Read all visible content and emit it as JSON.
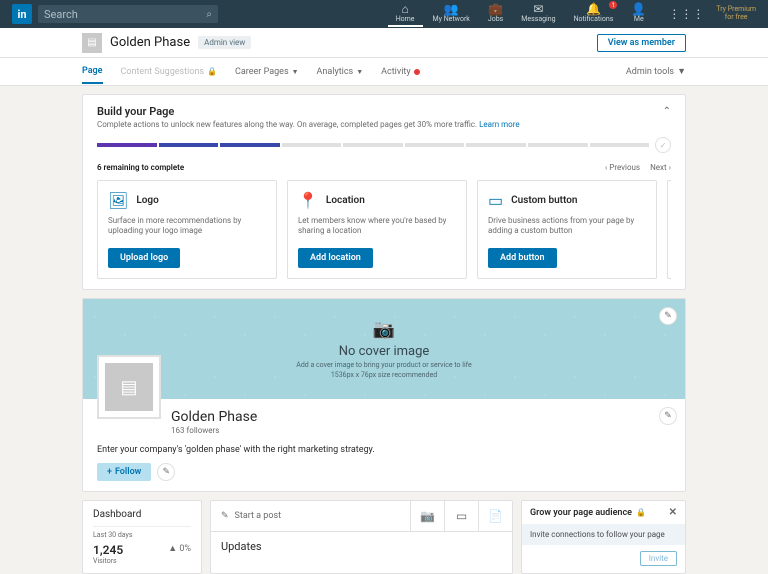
{
  "nav": {
    "search_placeholder": "Search",
    "items": [
      {
        "label": "Home",
        "icon": "home"
      },
      {
        "label": "My Network",
        "icon": "network"
      },
      {
        "label": "Jobs",
        "icon": "jobs"
      },
      {
        "label": "Messaging",
        "icon": "msg"
      },
      {
        "label": "Notifications",
        "icon": "bell",
        "badge": "1"
      },
      {
        "label": "Me",
        "icon": "me"
      }
    ],
    "premium_line1": "Try Premium",
    "premium_line2": "for free"
  },
  "header": {
    "page_name": "Golden Phase",
    "admin_badge": "Admin view",
    "view_as_member": "View as member"
  },
  "tabs": {
    "page": "Page",
    "content_suggestions": "Content Suggestions",
    "career_pages": "Career Pages",
    "analytics": "Analytics",
    "activity": "Activity",
    "admin_tools": "Admin tools"
  },
  "build": {
    "title": "Build your Page",
    "subtitle": "Complete actions to unlock new features along the way. On average, completed pages get 30% more traffic.",
    "learn_more": "Learn more",
    "remaining": "6 remaining to complete",
    "previous": "Previous",
    "next": "Next",
    "tasks": [
      {
        "title": "Logo",
        "desc": "Surface in more recommendations by uploading your logo image",
        "button": "Upload logo"
      },
      {
        "title": "Location",
        "desc": "Let members know where you're based by sharing a location",
        "button": "Add location"
      },
      {
        "title": "Custom button",
        "desc": "Drive business actions from your page by adding a custom button",
        "button": "Add button"
      }
    ]
  },
  "cover": {
    "title": "No cover image",
    "sub_line1": "Add a cover image to bring your product or service to life",
    "sub_line2": "1536px x 76px size recommended"
  },
  "profile": {
    "name": "Golden Phase",
    "followers": "163 followers",
    "tagline": "Enter your company's 'golden phase' with the right marketing strategy.",
    "follow_label": "Follow"
  },
  "dashboard": {
    "title": "Dashboard",
    "period": "Last 30 days",
    "visitors_count": "1,245",
    "visitors_pct": "▲ 0%",
    "visitors_label": "Visitors"
  },
  "post": {
    "start": "Start a post",
    "updates": "Updates"
  },
  "grow": {
    "title": "Grow your page audience",
    "subtitle": "Invite connections to follow your page",
    "invite": "Invite"
  }
}
